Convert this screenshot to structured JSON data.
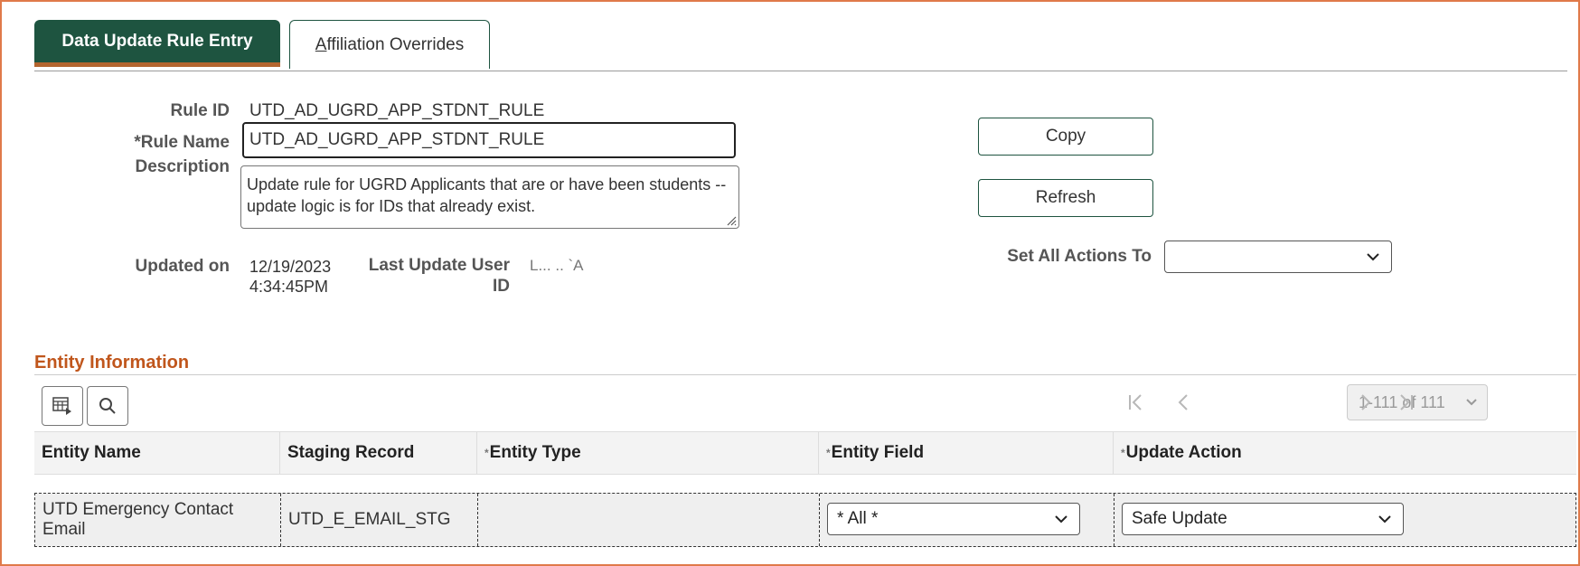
{
  "tabs": {
    "active_label": "Data Update Rule Entry",
    "inactive_label_initial": "A",
    "inactive_label_rest": "ffiliation Overrides"
  },
  "form": {
    "rule_id_label": "Rule ID",
    "rule_id_value": "UTD_AD_UGRD_APP_STDNT_RULE",
    "rule_name_label": "*Rule Name",
    "rule_name_value": "UTD_AD_UGRD_APP_STDNT_RULE",
    "description_label": "Description",
    "description_value": "Update rule for UGRD Applicants that are or have been students -- update logic is for IDs that already exist.",
    "updated_on_label": "Updated on",
    "updated_on_date": "12/19/2023",
    "updated_on_time": "4:34:45PM",
    "last_update_user_label_line1": "Last Update User",
    "last_update_user_label_line2": "ID",
    "last_update_user_value": "L...  ..  `A"
  },
  "actions": {
    "copy_label": "Copy",
    "refresh_label": "Refresh",
    "set_all_label": "Set All Actions To",
    "set_all_value": ""
  },
  "entity_section": {
    "title": "Entity Information",
    "pager_text": "1-111 of 111",
    "columns": [
      "Entity Name",
      "Staging Record",
      "Entity Type",
      "Entity Field",
      "Update Action"
    ],
    "rows": [
      {
        "entity_name": "UTD Emergency Contact Email",
        "staging_record": "UTD_E_EMAIL_STG",
        "entity_type": "",
        "entity_field": "* All *",
        "update_action": "Safe Update"
      }
    ]
  },
  "colors": {
    "tab_active_bg": "#1e5440",
    "tab_accent": "#b4652f",
    "section_title": "#c0561c",
    "frame_border": "#e07a4a"
  }
}
